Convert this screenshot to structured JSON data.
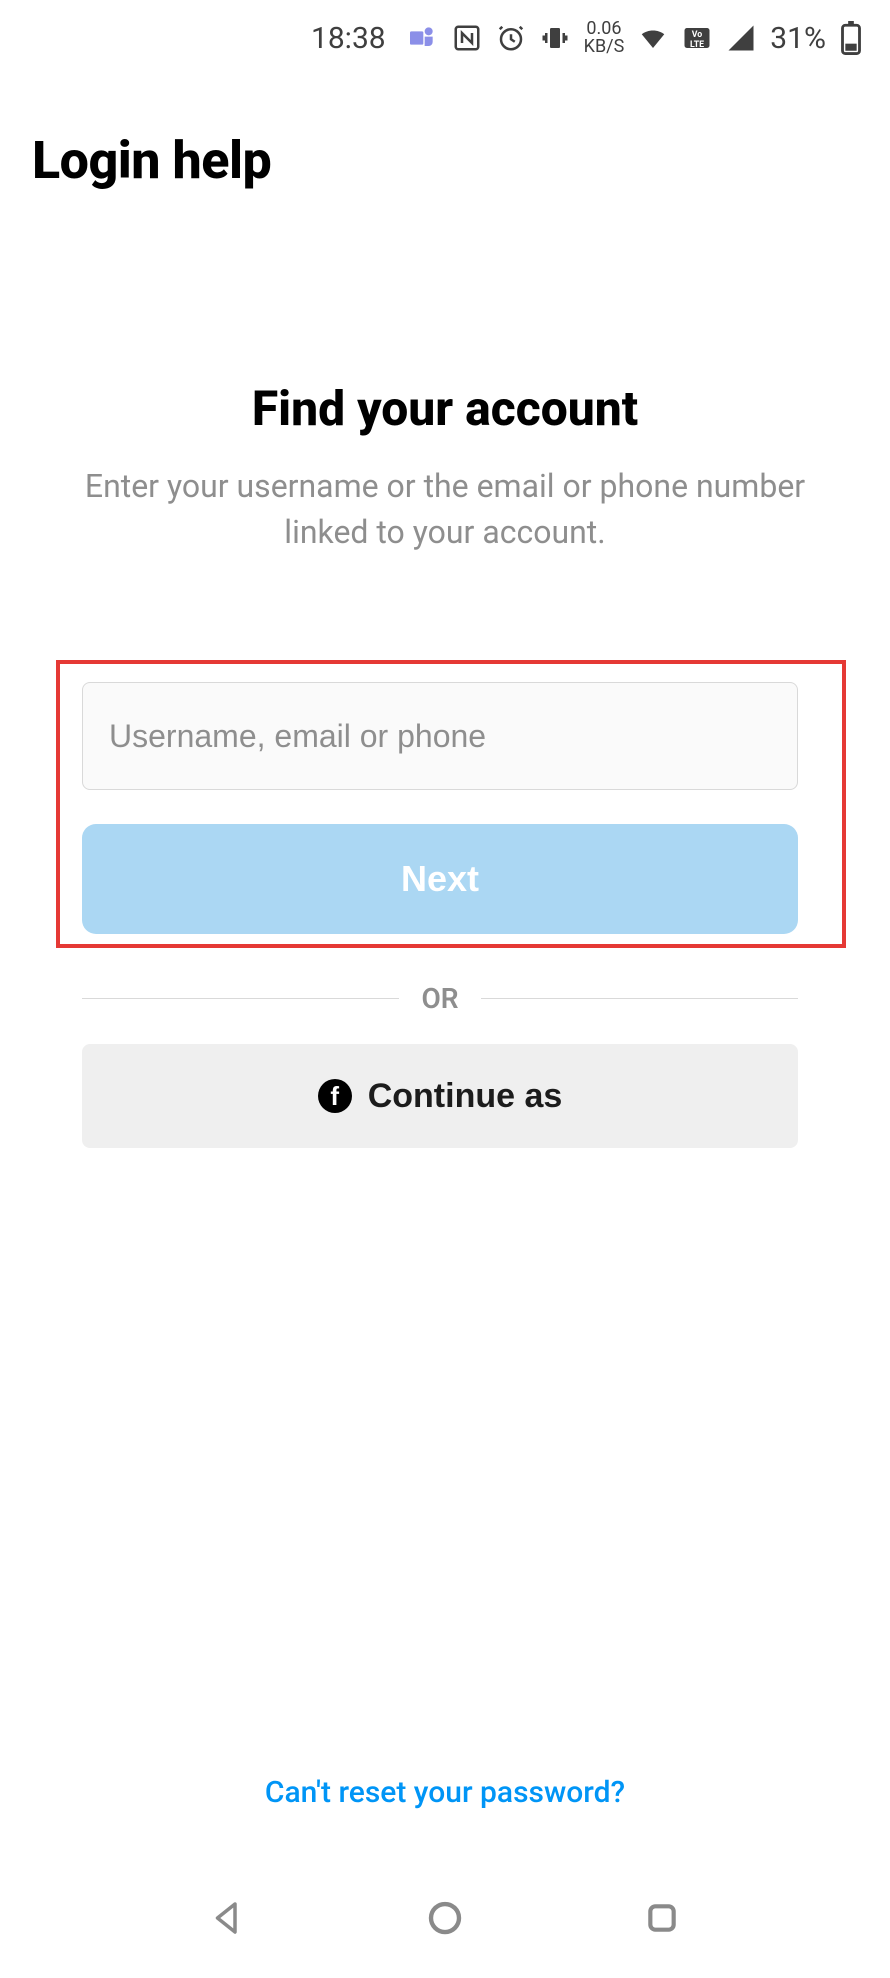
{
  "statusbar": {
    "clock": "18:38",
    "kbs_top": "0.06",
    "kbs_bottom": "KB/S",
    "battery_pct": "31%"
  },
  "header": {
    "title": "Login help"
  },
  "main": {
    "title": "Find your account",
    "subtitle": "Enter your username or the email or phone number linked to your account."
  },
  "form": {
    "username_placeholder": "Username, email or phone",
    "next_label": "Next"
  },
  "divider": {
    "label": "OR"
  },
  "facebook": {
    "label": "Continue as"
  },
  "footer_link": "Can't reset your password?"
}
